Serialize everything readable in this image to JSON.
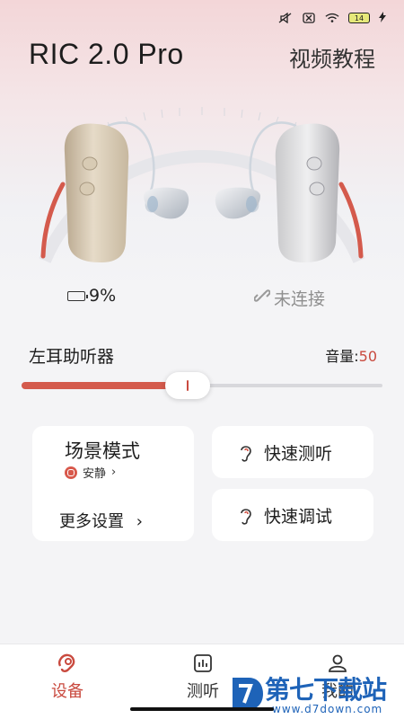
{
  "status_bar": {
    "battery": "14",
    "icons": [
      "mute-icon",
      "sim-off-icon",
      "wifi-icon",
      "battery-icon",
      "charging-icon"
    ]
  },
  "header": {
    "title": "RIC 2.0 Pro",
    "tutorial_link": "视频教程"
  },
  "devices": {
    "left_battery": "9%",
    "right_status": "未连接"
  },
  "volume": {
    "device_label": "左耳助听器",
    "label": "音量:",
    "value": "50",
    "level": 0.46
  },
  "scene_card": {
    "title": "场景模式",
    "current_scene": "安静",
    "current_scene_chevron": "›",
    "more_settings": "更多设置",
    "more_chevron": "›"
  },
  "quick_actions": {
    "quick_test": "快速测听",
    "quick_tune": "快速调试"
  },
  "tabbar": {
    "device": "设备",
    "test": "测听",
    "me": "我的"
  },
  "watermark": {
    "brand": "第七下载站",
    "url": "www.d7down.com"
  },
  "colors": {
    "accent": "#c94a3f",
    "watermark": "#1e63b8"
  }
}
